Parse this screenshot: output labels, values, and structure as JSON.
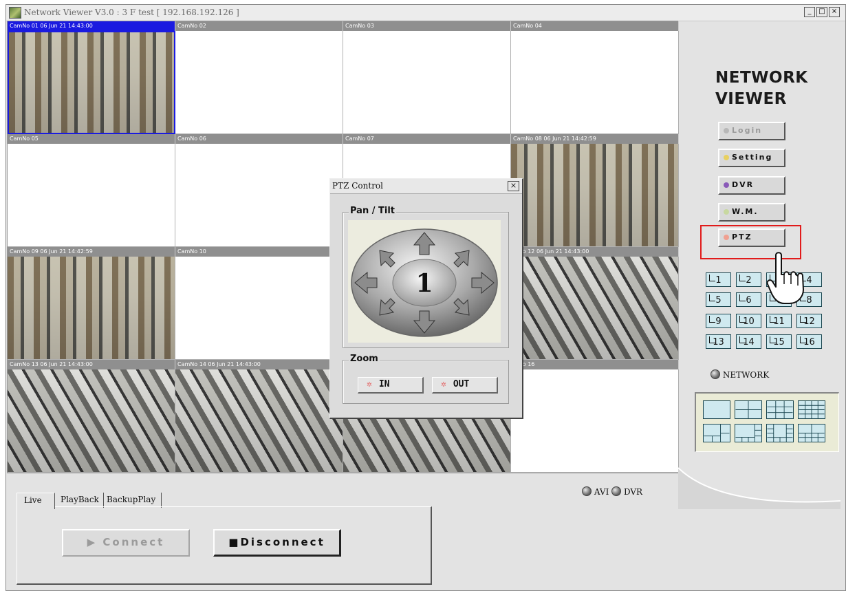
{
  "window": {
    "title": "Network Viewer V3.0 : 3 F test [ 192.168.192.126 ]",
    "minimize": "_",
    "maximize": "□",
    "close": "×"
  },
  "cameras": [
    {
      "label": "CamNo 01 06 Jun 21 14:43:00",
      "feed": true,
      "active": true
    },
    {
      "label": "CamNo 02",
      "feed": false
    },
    {
      "label": "CamNo 03",
      "feed": false
    },
    {
      "label": "CamNo 04",
      "feed": false
    },
    {
      "label": "CamNo 05",
      "feed": false
    },
    {
      "label": "CamNo 06",
      "feed": false
    },
    {
      "label": "CamNo 07",
      "feed": false
    },
    {
      "label": "CamNo 08 06 Jun 21 14:42:59",
      "feed": true
    },
    {
      "label": "CamNo 09 06 Jun 21 14:42:59",
      "feed": true
    },
    {
      "label": "CamNo 10",
      "feed": false
    },
    {
      "label": "",
      "feed": false
    },
    {
      "label": "mNo 12 06 Jun 21 14:43:00",
      "feed": true
    },
    {
      "label": "CamNo 13 06 Jun 21 14:43:00",
      "feed": true
    },
    {
      "label": "CamNo 14 06 Jun 21 14:43:00",
      "feed": true
    },
    {
      "label": "",
      "feed": true
    },
    {
      "label": "mNo 16",
      "feed": false
    }
  ],
  "logo": {
    "line1": "NETWORK",
    "line2": "VIEWER"
  },
  "side_buttons": {
    "login": "Login",
    "setting": "Setting",
    "dvr": "DVR",
    "wm": "W.M.",
    "ptz": "PTZ"
  },
  "channel_buttons": [
    "1",
    "2",
    "3",
    "4",
    "5",
    "6",
    "7",
    "8",
    "9",
    "10",
    "11",
    "12",
    "13",
    "14",
    "15",
    "16"
  ],
  "network_label": "NETWORK",
  "record_status": {
    "avi": "AVI",
    "dvr": "DVR"
  },
  "tabs": {
    "live": "Live",
    "playback": "PlayBack",
    "backup": "BackupPlay"
  },
  "connect": {
    "connect": "Connect",
    "disconnect": "Disconnect"
  },
  "ptz_dialog": {
    "title": "PTZ Control",
    "close": "×",
    "pan_tilt_label": "Pan / Tilt",
    "center_number": "1",
    "zoom_label": "Zoom",
    "zoom_in": "IN",
    "zoom_out": "OUT"
  },
  "colors": {
    "active_camera": "#1a1ae0",
    "highlight": "#e11b1b",
    "channel_button": "#cfe9ef"
  }
}
